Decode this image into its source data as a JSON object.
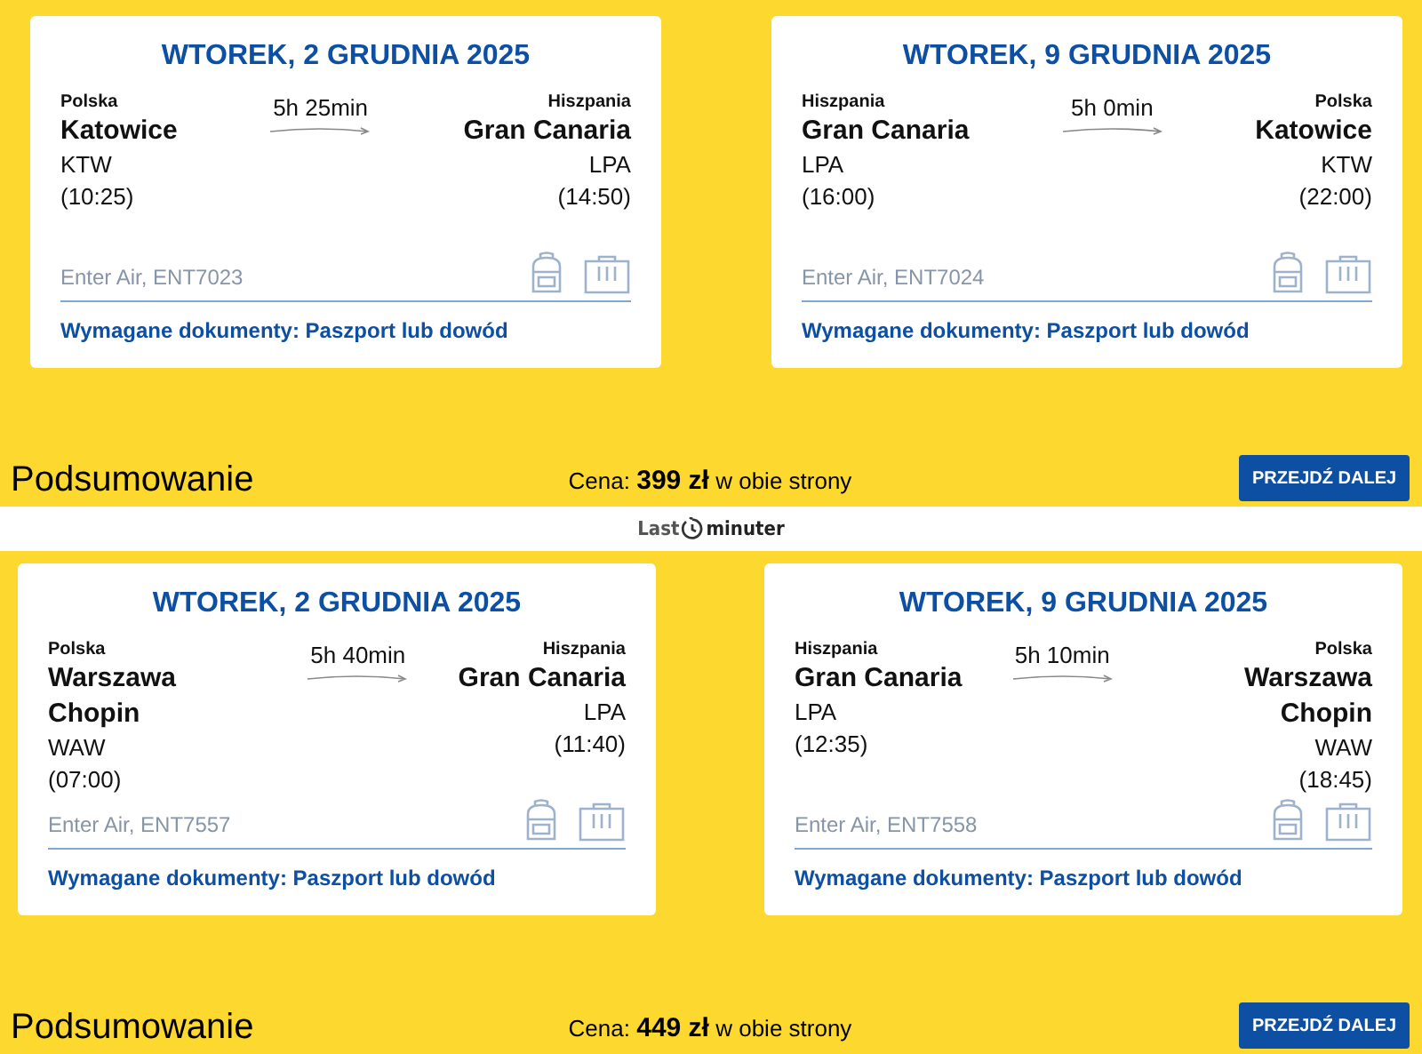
{
  "upper_panel": {
    "flights": [
      {
        "date": "WTOREK, 2 GRUDNIA 2025",
        "duration": "5h 25min",
        "from": {
          "country": "Polska",
          "city": "Katowice",
          "code": "KTW",
          "time": "(10:25)"
        },
        "to": {
          "country": "Hiszpania",
          "city": "Gran Canaria",
          "code": "LPA",
          "time": "(14:50)"
        },
        "flight": "Enter Air, ENT7023",
        "documents": "Wymagane dokumenty: Paszport lub dowód"
      },
      {
        "date": "WTOREK, 9 GRUDNIA 2025",
        "duration": "5h 0min",
        "from": {
          "country": "Hiszpania",
          "city": "Gran Canaria",
          "code": "LPA",
          "time": "(16:00)"
        },
        "to": {
          "country": "Polska",
          "city": "Katowice",
          "code": "KTW",
          "time": "(22:00)"
        },
        "flight": "Enter Air, ENT7024",
        "documents": "Wymagane dokumenty: Paszport lub dowód"
      }
    ],
    "summary": {
      "title": "Podsumowanie",
      "price": "Cena: **399 zł** w obie strony",
      "button": "PRZEJDŹ DALEJ"
    }
  },
  "logo": {
    "left": "Last",
    "right": "minuter"
  },
  "lower_panel": {
    "flights": [
      {
        "date": "WTOREK, 2 GRUDNIA 2025",
        "duration": "5h 40min",
        "from": {
          "country": "Polska",
          "city": "Warszawa Chopin",
          "code": "WAW",
          "time": "(07:00)"
        },
        "to": {
          "country": "Hiszpania",
          "city": "Gran Canaria",
          "code": "LPA",
          "time": "(11:40)"
        },
        "flight": "Enter Air, ENT7557",
        "documents": "Wymagane dokumenty: Paszport lub dowód"
      },
      {
        "date": "WTOREK, 9 GRUDNIA 2025",
        "duration": "5h 10min",
        "from": {
          "country": "Hiszpania",
          "city": "Gran Canaria",
          "code": "LPA",
          "time": "(12:35)"
        },
        "to": {
          "country": "Polska",
          "city": "Warszawa Chopin",
          "code": "WAW",
          "time": "(18:45)"
        },
        "flight": "Enter Air, ENT7558",
        "documents": "Wymagane dokumenty: Paszport lub dowód"
      }
    ],
    "summary": {
      "title": "Podsumowanie",
      "price": "Cena: **449 zł** w obie strony",
      "button": "PRZEJDŹ DALEJ"
    }
  }
}
